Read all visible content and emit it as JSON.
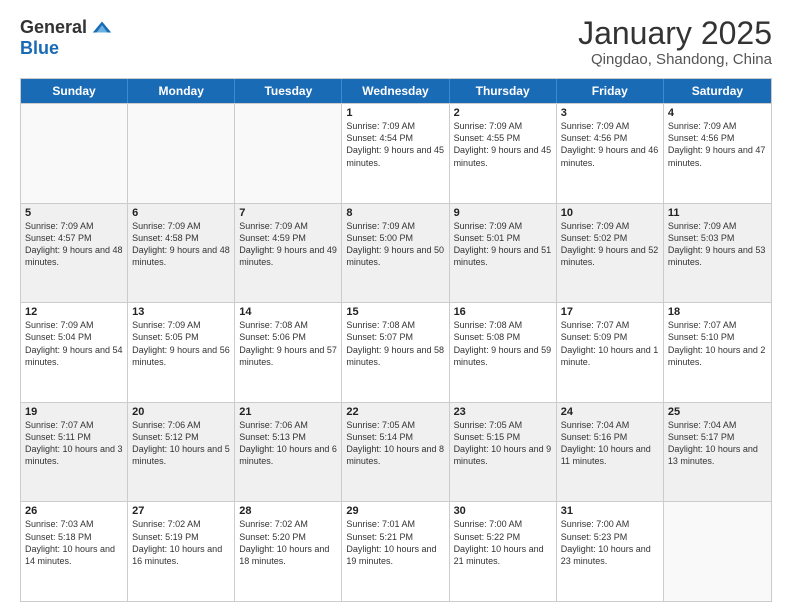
{
  "header": {
    "logo_general": "General",
    "logo_blue": "Blue",
    "title": "January 2025",
    "subtitle": "Qingdao, Shandong, China"
  },
  "weekdays": [
    "Sunday",
    "Monday",
    "Tuesday",
    "Wednesday",
    "Thursday",
    "Friday",
    "Saturday"
  ],
  "rows": [
    [
      {
        "day": "",
        "info": "",
        "empty": true
      },
      {
        "day": "",
        "info": "",
        "empty": true
      },
      {
        "day": "",
        "info": "",
        "empty": true
      },
      {
        "day": "1",
        "info": "Sunrise: 7:09 AM\nSunset: 4:54 PM\nDaylight: 9 hours and 45 minutes."
      },
      {
        "day": "2",
        "info": "Sunrise: 7:09 AM\nSunset: 4:55 PM\nDaylight: 9 hours and 45 minutes."
      },
      {
        "day": "3",
        "info": "Sunrise: 7:09 AM\nSunset: 4:56 PM\nDaylight: 9 hours and 46 minutes."
      },
      {
        "day": "4",
        "info": "Sunrise: 7:09 AM\nSunset: 4:56 PM\nDaylight: 9 hours and 47 minutes."
      }
    ],
    [
      {
        "day": "5",
        "info": "Sunrise: 7:09 AM\nSunset: 4:57 PM\nDaylight: 9 hours and 48 minutes."
      },
      {
        "day": "6",
        "info": "Sunrise: 7:09 AM\nSunset: 4:58 PM\nDaylight: 9 hours and 48 minutes."
      },
      {
        "day": "7",
        "info": "Sunrise: 7:09 AM\nSunset: 4:59 PM\nDaylight: 9 hours and 49 minutes."
      },
      {
        "day": "8",
        "info": "Sunrise: 7:09 AM\nSunset: 5:00 PM\nDaylight: 9 hours and 50 minutes."
      },
      {
        "day": "9",
        "info": "Sunrise: 7:09 AM\nSunset: 5:01 PM\nDaylight: 9 hours and 51 minutes."
      },
      {
        "day": "10",
        "info": "Sunrise: 7:09 AM\nSunset: 5:02 PM\nDaylight: 9 hours and 52 minutes."
      },
      {
        "day": "11",
        "info": "Sunrise: 7:09 AM\nSunset: 5:03 PM\nDaylight: 9 hours and 53 minutes."
      }
    ],
    [
      {
        "day": "12",
        "info": "Sunrise: 7:09 AM\nSunset: 5:04 PM\nDaylight: 9 hours and 54 minutes."
      },
      {
        "day": "13",
        "info": "Sunrise: 7:09 AM\nSunset: 5:05 PM\nDaylight: 9 hours and 56 minutes."
      },
      {
        "day": "14",
        "info": "Sunrise: 7:08 AM\nSunset: 5:06 PM\nDaylight: 9 hours and 57 minutes."
      },
      {
        "day": "15",
        "info": "Sunrise: 7:08 AM\nSunset: 5:07 PM\nDaylight: 9 hours and 58 minutes."
      },
      {
        "day": "16",
        "info": "Sunrise: 7:08 AM\nSunset: 5:08 PM\nDaylight: 9 hours and 59 minutes."
      },
      {
        "day": "17",
        "info": "Sunrise: 7:07 AM\nSunset: 5:09 PM\nDaylight: 10 hours and 1 minute."
      },
      {
        "day": "18",
        "info": "Sunrise: 7:07 AM\nSunset: 5:10 PM\nDaylight: 10 hours and 2 minutes."
      }
    ],
    [
      {
        "day": "19",
        "info": "Sunrise: 7:07 AM\nSunset: 5:11 PM\nDaylight: 10 hours and 3 minutes."
      },
      {
        "day": "20",
        "info": "Sunrise: 7:06 AM\nSunset: 5:12 PM\nDaylight: 10 hours and 5 minutes."
      },
      {
        "day": "21",
        "info": "Sunrise: 7:06 AM\nSunset: 5:13 PM\nDaylight: 10 hours and 6 minutes."
      },
      {
        "day": "22",
        "info": "Sunrise: 7:05 AM\nSunset: 5:14 PM\nDaylight: 10 hours and 8 minutes."
      },
      {
        "day": "23",
        "info": "Sunrise: 7:05 AM\nSunset: 5:15 PM\nDaylight: 10 hours and 9 minutes."
      },
      {
        "day": "24",
        "info": "Sunrise: 7:04 AM\nSunset: 5:16 PM\nDaylight: 10 hours and 11 minutes."
      },
      {
        "day": "25",
        "info": "Sunrise: 7:04 AM\nSunset: 5:17 PM\nDaylight: 10 hours and 13 minutes."
      }
    ],
    [
      {
        "day": "26",
        "info": "Sunrise: 7:03 AM\nSunset: 5:18 PM\nDaylight: 10 hours and 14 minutes."
      },
      {
        "day": "27",
        "info": "Sunrise: 7:02 AM\nSunset: 5:19 PM\nDaylight: 10 hours and 16 minutes."
      },
      {
        "day": "28",
        "info": "Sunrise: 7:02 AM\nSunset: 5:20 PM\nDaylight: 10 hours and 18 minutes."
      },
      {
        "day": "29",
        "info": "Sunrise: 7:01 AM\nSunset: 5:21 PM\nDaylight: 10 hours and 19 minutes."
      },
      {
        "day": "30",
        "info": "Sunrise: 7:00 AM\nSunset: 5:22 PM\nDaylight: 10 hours and 21 minutes."
      },
      {
        "day": "31",
        "info": "Sunrise: 7:00 AM\nSunset: 5:23 PM\nDaylight: 10 hours and 23 minutes."
      },
      {
        "day": "",
        "info": "",
        "empty": true
      }
    ]
  ]
}
